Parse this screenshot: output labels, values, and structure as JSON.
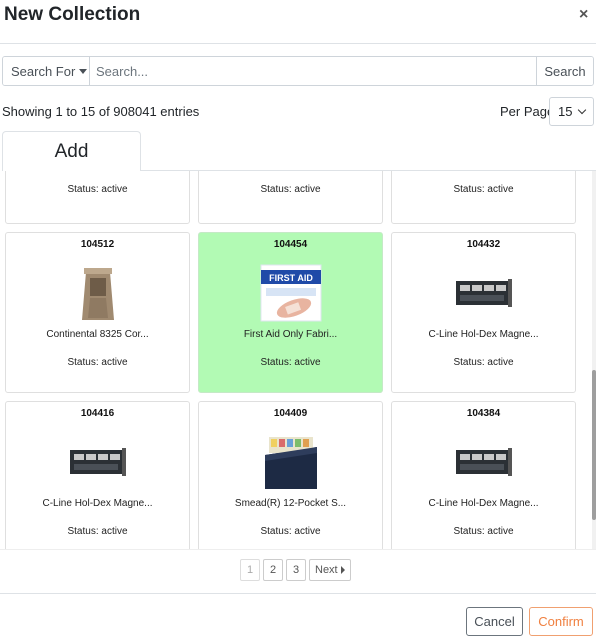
{
  "modal": {
    "title": "New Collection",
    "close_glyph": "×"
  },
  "search": {
    "search_for_label": "Search For",
    "placeholder": "Search...",
    "button_label": "Search"
  },
  "listing": {
    "showing_text": "Showing 1 to 15 of 908041 entries",
    "per_page_label": "Per Page:",
    "per_page_value": "15"
  },
  "tabs": {
    "add_label": "Add"
  },
  "cards": [
    {
      "id": "",
      "name": "",
      "status": "Status: active",
      "selected": false,
      "image": "none"
    },
    {
      "id": "",
      "name": "",
      "status": "Status: active",
      "selected": false,
      "image": "none"
    },
    {
      "id": "",
      "name": "",
      "status": "Status: active",
      "selected": false,
      "image": "none"
    },
    {
      "id": "104512",
      "name": "Continental 8325 Cor...",
      "status": "Status: active",
      "selected": false,
      "image": "waste-receptacle-image"
    },
    {
      "id": "104454",
      "name": "First Aid Only Fabri...",
      "status": "Status: active",
      "selected": true,
      "image": "first-aid-box-image"
    },
    {
      "id": "104432",
      "name": "C-Line Hol-Dex Magne...",
      "status": "Status: active",
      "selected": false,
      "image": "label-holder-image"
    },
    {
      "id": "104416",
      "name": "C-Line Hol-Dex Magne...",
      "status": "Status: active",
      "selected": false,
      "image": "label-holder-image"
    },
    {
      "id": "104409",
      "name": "Smead(R) 12-Pocket S...",
      "status": "Status: active",
      "selected": false,
      "image": "file-organizer-image"
    },
    {
      "id": "104384",
      "name": "C-Line Hol-Dex Magne...",
      "status": "Status: active",
      "selected": false,
      "image": "label-holder-image"
    }
  ],
  "pagination": {
    "pages": [
      "1",
      "2",
      "3"
    ],
    "current": "1",
    "next_label": "Next"
  },
  "footer": {
    "cancel_label": "Cancel",
    "confirm_label": "Confirm"
  },
  "colors": {
    "selected_card_bg": "#b2fab4",
    "confirm_accent": "#f08040"
  },
  "images": {
    "first_aid_text": "FIRST AID"
  }
}
